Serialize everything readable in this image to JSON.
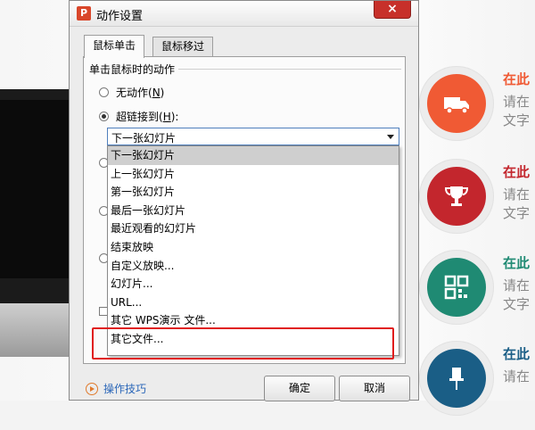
{
  "dialog": {
    "title": "动作设置",
    "app_icon": "P",
    "close_label": "×",
    "tabs": [
      {
        "label": "鼠标单击",
        "active": true
      },
      {
        "label": "鼠标移过",
        "active": false
      }
    ],
    "group_title": "单击鼠标时的动作",
    "radios": [
      {
        "prefix": "无动作(",
        "key": "N",
        "suffix": ")",
        "checked": false
      },
      {
        "prefix": "超链接到(",
        "key": "H",
        "suffix": "):",
        "checked": true
      }
    ],
    "hyperlink_select": {
      "value": "下一张幻灯片",
      "options": [
        "下一张幻灯片",
        "上一张幻灯片",
        "第一张幻灯片",
        "最后一张幻灯片",
        "最近观看的幻灯片",
        "结束放映",
        "自定义放映...",
        "幻灯片...",
        "URL...",
        "其它 WPS演示 文件...",
        "其它文件..."
      ]
    },
    "tips_label": "操作技巧",
    "ok_label": "确定",
    "cancel_label": "取消"
  },
  "slide": {
    "items": [
      {
        "title": "在此",
        "lines": [
          "请在",
          "文字"
        ],
        "color": "#f05a34",
        "icon": "truck-icon"
      },
      {
        "title": "在此",
        "lines": [
          "请在",
          "文字"
        ],
        "color": "#c3262d",
        "icon": "trophy-icon"
      },
      {
        "title": "在此",
        "lines": [
          "请在",
          "文字"
        ],
        "color": "#1f8a73",
        "icon": "qr-code-icon"
      },
      {
        "title": "在此",
        "lines": [
          "请在"
        ],
        "color": "#1a5e86",
        "icon": "pushpin-icon"
      }
    ]
  },
  "colors": {
    "annotation": "#e01c1c",
    "link": "#2a66b8"
  }
}
